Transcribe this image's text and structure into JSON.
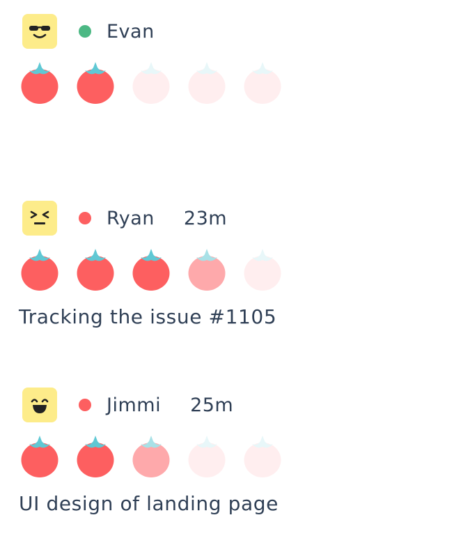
{
  "colors": {
    "avatar_bg": "#fdec8a",
    "status_online": "#4cb884",
    "status_busy": "#fd5f60",
    "tomato_done": "#fd5f60",
    "tomato_progress": "#fea9ab",
    "tomato_empty": "#ffeeef",
    "stem_done": "#5fc8d4",
    "stem_progress": "#a8e1e7",
    "stem_empty": "#e8f7f9",
    "text": "#2f3f55"
  },
  "members": [
    {
      "name": "Evan",
      "time": "",
      "note": "",
      "status": "online",
      "avatar_icon": "sunglasses-face-icon",
      "tomatoes": [
        "done",
        "done",
        "empty",
        "empty",
        "empty"
      ]
    },
    {
      "name": "Ryan",
      "time": "23m",
      "note": "Tracking the issue #1105",
      "status": "busy",
      "avatar_icon": "squinting-face-icon",
      "tomatoes": [
        "done",
        "done",
        "done",
        "progress",
        "empty"
      ]
    },
    {
      "name": "Jimmi",
      "time": "25m",
      "note": "UI design of landing page",
      "status": "busy",
      "avatar_icon": "grinning-face-icon",
      "tomatoes": [
        "done",
        "done",
        "progress",
        "empty",
        "empty"
      ]
    }
  ]
}
